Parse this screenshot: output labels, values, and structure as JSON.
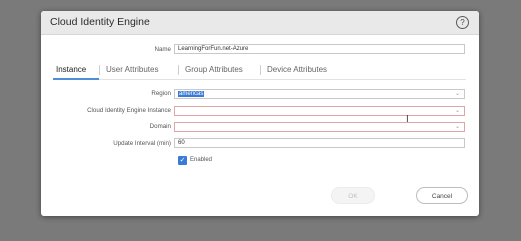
{
  "dialog": {
    "title": "Cloud Identity Engine",
    "help_icon": "?",
    "name_label": "Name",
    "name_value": "LearningForFun.net-Azure"
  },
  "tabs": [
    {
      "label": "Instance",
      "active": true
    },
    {
      "label": "User Attributes",
      "active": false
    },
    {
      "label": "Group Attributes",
      "active": false
    },
    {
      "label": "Device Attributes",
      "active": false
    }
  ],
  "form": {
    "region_label": "Region",
    "region_value": "americas",
    "instance_label": "Cloud Identity Engine Instance",
    "instance_value": "",
    "domain_label": "Domain",
    "domain_value": "",
    "interval_label": "Update Interval (min)",
    "interval_value": "60",
    "enabled_label": "Enabled",
    "enabled_checked": true
  },
  "buttons": {
    "ok_label": "OK",
    "cancel_label": "Cancel"
  },
  "icons": {
    "chevron": "chevron-down-icon",
    "check": "check-icon",
    "help": "help-icon",
    "cursor": "text-cursor-icon"
  },
  "colors": {
    "accent": "#3a7bd5",
    "error_border": "#e0a5a5"
  }
}
